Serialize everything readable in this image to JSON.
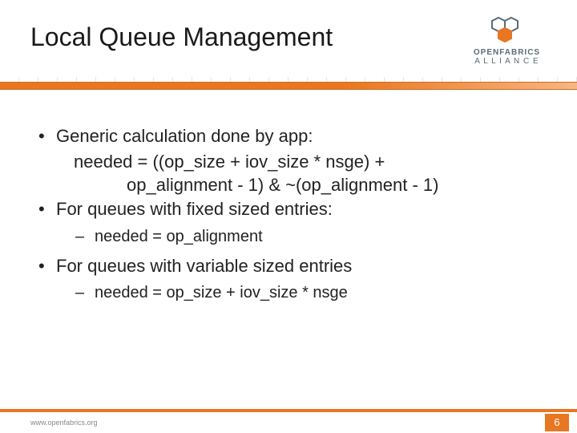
{
  "title": "Local Queue Management",
  "logo": {
    "line1": "OPENFABRICS",
    "line2": "A L L I A N C E"
  },
  "bullets": {
    "b1": "Generic calculation done by app:",
    "b1_line2": "needed = ((op_size + iov_size * nsge) +",
    "b1_line3": "op_alignment - 1) & ~(op_alignment - 1)",
    "b2": "For queues with fixed sized entries:",
    "b2_sub": "needed = op_alignment",
    "b3": "For queues with variable sized entries",
    "b3_sub": "needed = op_size + iov_size * nsge"
  },
  "footer": {
    "url": "www.openfabrics.org",
    "page": "6"
  }
}
